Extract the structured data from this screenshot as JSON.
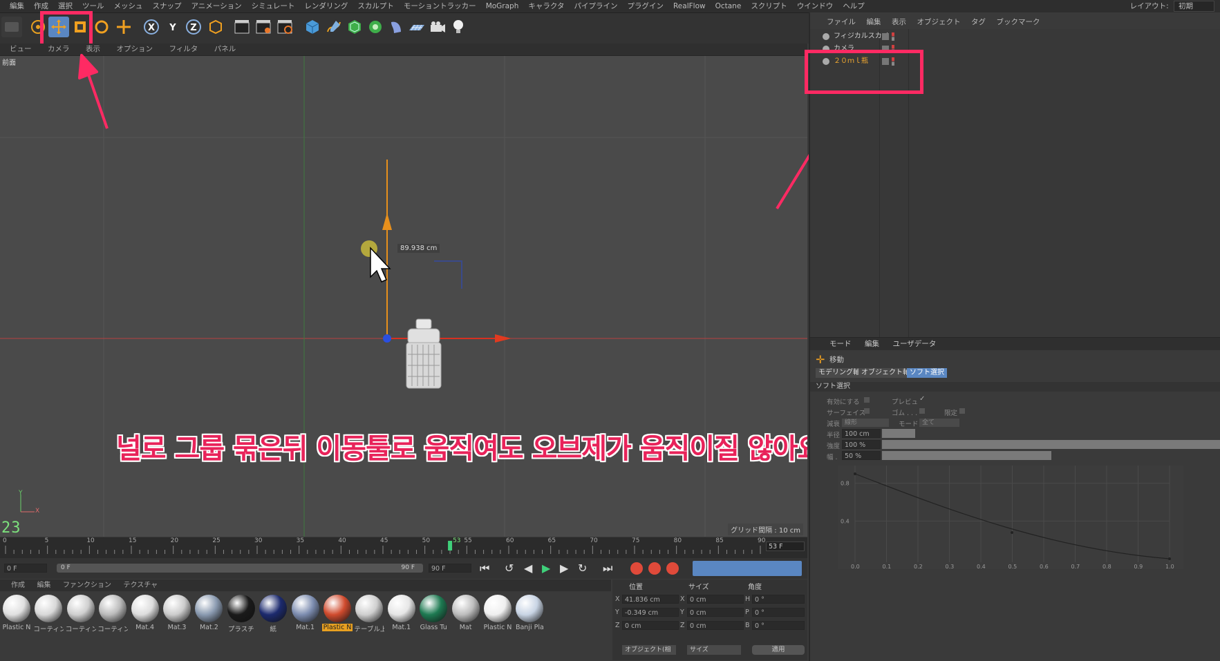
{
  "menubar": {
    "items": [
      "編集",
      "作成",
      "選択",
      "ツール",
      "メッシュ",
      "スナップ",
      "アニメーション",
      "シミュレート",
      "レンダリング",
      "スカルプト",
      "モーショントラッカー",
      "MoGraph",
      "キャラクタ",
      "パイプライン",
      "プラグイン",
      "RealFlow",
      "Octane",
      "スクリプト",
      "ウインドウ",
      "ヘルプ"
    ],
    "layout_label": "レイアウト:",
    "layout_value": "初期"
  },
  "viewport": {
    "menu": [
      "ビュー",
      "カメラ",
      "表示",
      "オプション",
      "フィルタ",
      "パネル"
    ],
    "view_name": "前面",
    "value_label": "89.938 cm",
    "grid_spacing": "グリッド間隔 : 10 cm",
    "frame_number": "23",
    "axis_y": "Y",
    "axis_x": "X"
  },
  "caption": "널로 그룹 묶은뒤 이동툴로 움직여도 오브제가 움직이질 않아요",
  "timeline": {
    "ticks": [
      "0",
      "5",
      "10",
      "15",
      "20",
      "25",
      "30",
      "35",
      "40",
      "45",
      "50",
      "55",
      "60",
      "65",
      "70",
      "75",
      "80",
      "85",
      "90"
    ],
    "current": "53",
    "current_field": "53 F",
    "start_field": "0 F",
    "slider_start": "0 F",
    "slider_end": "90 F",
    "end_field": "90 F"
  },
  "materials": {
    "menu": [
      "作成",
      "編集",
      "ファンクション",
      "テクスチャ"
    ],
    "items": [
      {
        "label": "Plastic N",
        "color": "#e0e0e0"
      },
      {
        "label": "コーティン",
        "color": "#d8d8d8"
      },
      {
        "label": "コーティン",
        "color": "#cfcfcf"
      },
      {
        "label": "コーティン",
        "color": "#bbbbbb"
      },
      {
        "label": "Mat.4",
        "color": "#dddddd"
      },
      {
        "label": "Mat.3",
        "color": "#cccccc"
      },
      {
        "label": "Mat.2",
        "color": "#8a9ab0"
      },
      {
        "label": "プラスチ",
        "color": "#1a1a1a"
      },
      {
        "label": "紙",
        "color": "#1c2a6e"
      },
      {
        "label": "Mat.1",
        "color": "#7d8db0"
      },
      {
        "label": "Plastic N",
        "color": "#d04b2e",
        "highlight": true
      },
      {
        "label": "テーブル上",
        "color": "#cfcfcf"
      },
      {
        "label": "Mat.1",
        "color": "#e6e6e6"
      },
      {
        "label": "Glass Tu",
        "color": "#1e7a52"
      },
      {
        "label": "Mat",
        "color": "#bdbdbd"
      },
      {
        "label": "Plastic N",
        "color": "#efefef"
      },
      {
        "label": "Banji Pla",
        "color": "#c8d4e4"
      }
    ]
  },
  "coords": {
    "headers": [
      "位置",
      "サイズ",
      "角度"
    ],
    "rows": [
      {
        "axis": "X",
        "pos": "41.836 cm",
        "size_axis": "X",
        "size": "0 cm",
        "rot_axis": "H",
        "rot": "0 °"
      },
      {
        "axis": "Y",
        "pos": "-0.349 cm",
        "size_axis": "Y",
        "size": "0 cm",
        "rot_axis": "P",
        "rot": "0 °"
      },
      {
        "axis": "Z",
        "pos": "0 cm",
        "size_axis": "Z",
        "size": "0 cm",
        "rot_axis": "B",
        "rot": "0 °"
      }
    ],
    "mode": "オブジェクト(相",
    "size_mode": "サイズ",
    "apply": "適用"
  },
  "object_manager": {
    "menu": [
      "ファイル",
      "編集",
      "表示",
      "オブジェクト",
      "タグ",
      "ブックマーク"
    ],
    "rows": [
      {
        "name": "フィジカルスカイ",
        "color": "#cfcfcf"
      },
      {
        "name": "カメラ",
        "color": "#cfcfcf"
      },
      {
        "name": "２０ｍｌ瓶",
        "color": "#f0a830"
      }
    ]
  },
  "attributes": {
    "menu": [
      "モード",
      "編集",
      "ユーザデータ"
    ],
    "tool_name": "移動",
    "tabs": [
      "モデリング軸",
      "オブジェクト軸",
      "ソフト選択"
    ],
    "section": "ソフト選択",
    "enable": "有効にする",
    "preview": "プレビュ",
    "surface": "サーフェイス",
    "rubber": "ゴム . . .",
    "restrict": "限定",
    "falloff_label": "減衰",
    "falloff_value": "線形",
    "mode_label": "モード",
    "mode_value": "全て",
    "radius_label": "半径",
    "radius_value": "100 cm",
    "strength_label": "強度",
    "strength_value": "100 %",
    "width_label": "幅 .",
    "width_value": "50 %",
    "graph_y": [
      "0.8",
      "0.4"
    ],
    "graph_x": [
      "0.0",
      "0.1",
      "0.2",
      "0.3",
      "0.4",
      "0.5",
      "0.6",
      "0.7",
      "0.8",
      "0.9",
      "1.0"
    ]
  }
}
